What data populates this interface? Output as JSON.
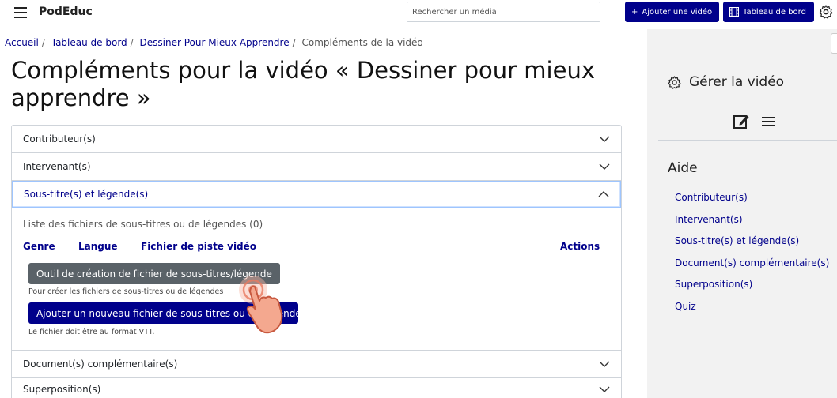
{
  "header": {
    "brand": "PodEduc",
    "search_placeholder": "Rechercher un média",
    "add_video_label": "Ajouter une vidéo",
    "dashboard_label": "Tableau de bord"
  },
  "breadcrumb": {
    "items": [
      "Accueil",
      "Tableau de bord",
      "Dessiner Pour Mieux Apprendre"
    ],
    "current": "Compléments de la vidéo"
  },
  "page_title": "Compléments pour la vidéo « Dessiner pour mieux apprendre »",
  "accordion": {
    "contributors": "Contributeur(s)",
    "speakers": "Intervenant(s)",
    "subtitles": "Sous-titre(s) et légende(s)",
    "documents": "Document(s) complémentaire(s)",
    "overlays": "Superposition(s)"
  },
  "subtitles_panel": {
    "list_title": "Liste des fichiers de sous-titres ou de légendes (0)",
    "col_genre": "Genre",
    "col_language": "Langue",
    "col_track": "Fichier de piste vidéo",
    "col_actions": "Actions",
    "tool_button": "Outil de création de fichier de sous-titres/légende",
    "tool_help": "Pour créer les fichiers de sous-titres ou de légendes",
    "new_button": "Ajouter un nouveau fichier de sous-titres ou de légende",
    "new_help": "Le fichier doit être au format VTT."
  },
  "sidebar": {
    "manage_title": "Gérer la vidéo",
    "help_title": "Aide",
    "links": [
      "Contributeur(s)",
      "Intervenant(s)",
      "Sous-titre(s) et légende(s)",
      "Document(s) complémentaire(s)",
      "Superposition(s)",
      "Quiz"
    ]
  },
  "colors": {
    "primary": "#00008b",
    "secondary": "#5a6268",
    "sidebar_bg": "#f2f2f2"
  }
}
